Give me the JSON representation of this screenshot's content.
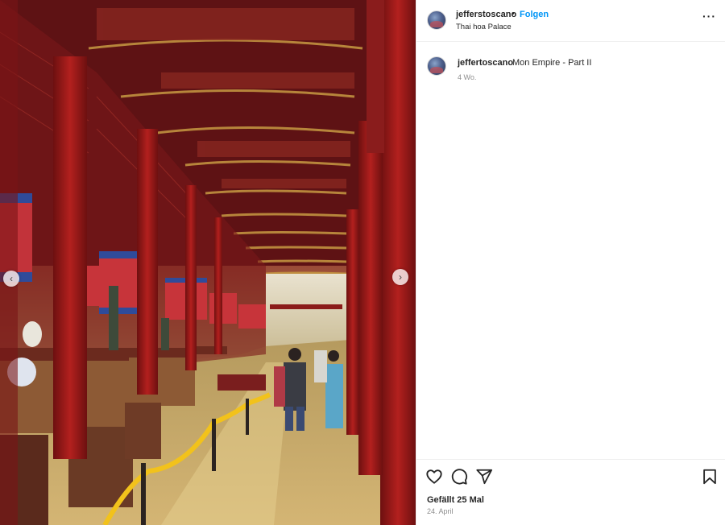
{
  "post": {
    "username": "jefferstoscano",
    "separator": "•",
    "follow_label": "Folgen",
    "location": "Thai hoa Palace",
    "more_label": "···"
  },
  "caption": {
    "username": "jeffertoscano",
    "text": "Mon Empire - Part II",
    "time": "4 Wo."
  },
  "footer": {
    "likes": "Gefällt 25 Mal",
    "date": "24. April"
  },
  "icons": {
    "like": "heart-icon",
    "comment": "comment-icon",
    "share": "paper-plane-icon",
    "save": "bookmark-icon",
    "prev": "chevron-left-icon",
    "next": "chevron-right-icon"
  },
  "colors": {
    "accent": "#0095f6",
    "text": "#262626",
    "muted": "#8e8e8e"
  }
}
